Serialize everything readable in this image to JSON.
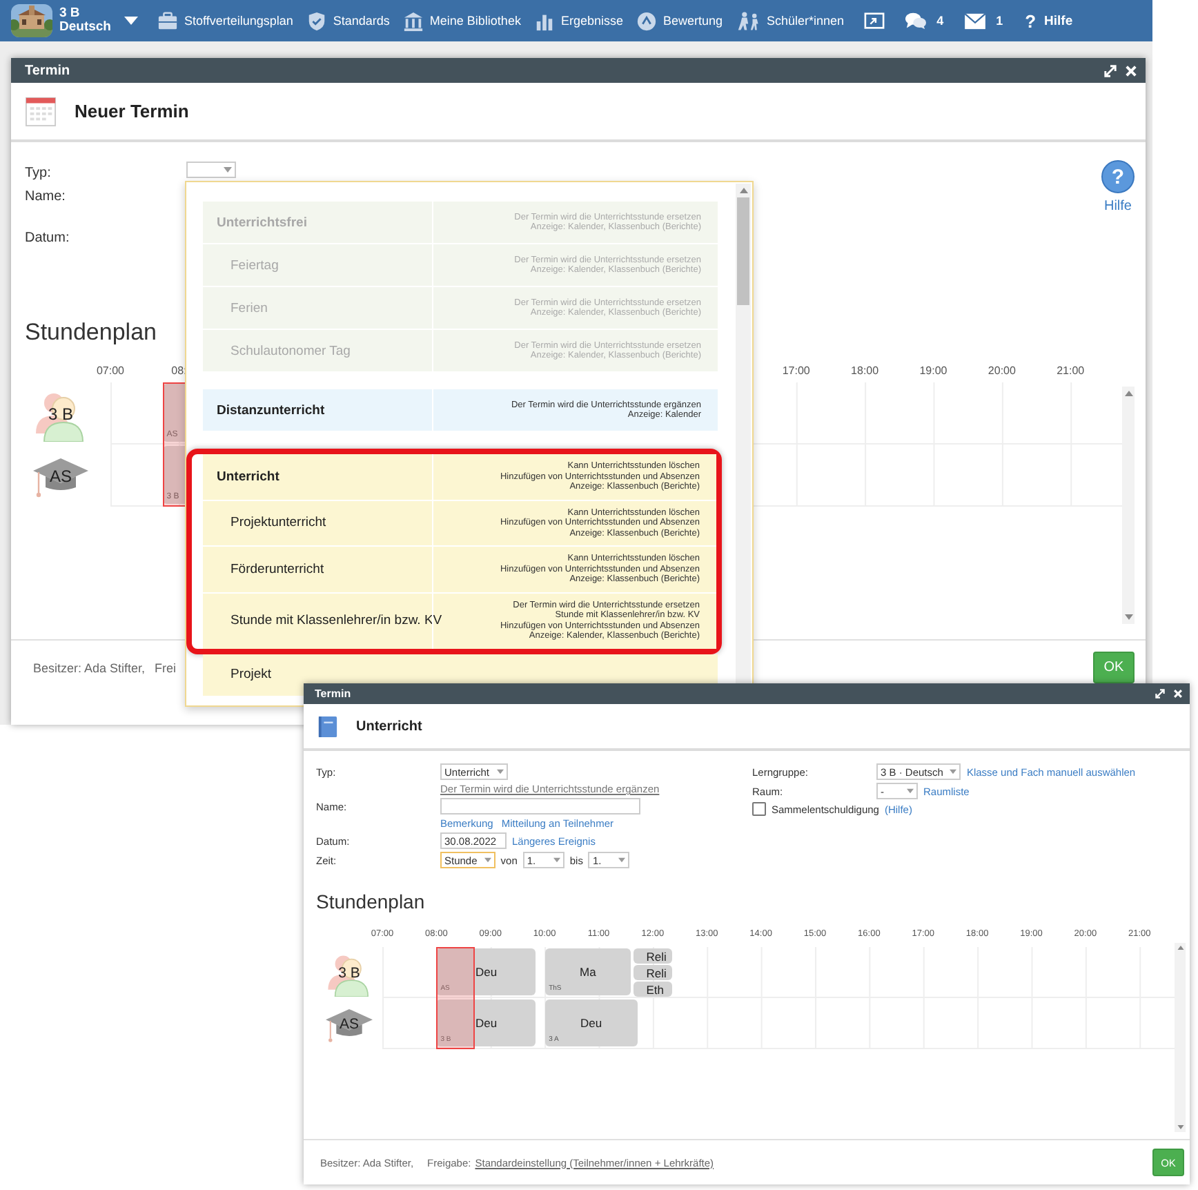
{
  "nav": {
    "class_label": "3 B",
    "subject_label": "Deutsch",
    "items": [
      {
        "label": "Stoffverteilungsplan"
      },
      {
        "label": "Standards"
      },
      {
        "label": "Meine Bibliothek"
      },
      {
        "label": "Ergebnisse"
      },
      {
        "label": "Bewertung"
      },
      {
        "label": "Schüler*innen"
      }
    ],
    "counters": [
      {
        "count": "4"
      },
      {
        "count": "1"
      }
    ],
    "help": {
      "glyph": "?",
      "label": "Hilfe"
    }
  },
  "dialog_new": {
    "title": "Termin",
    "heading": "Neuer Termin",
    "labels": [
      "Typ:",
      "Name:",
      "Datum:"
    ],
    "help": {
      "glyph": "?",
      "label": "Hilfe"
    },
    "schedule_title": "Stundenplan",
    "hours_left": [
      "07:00",
      "08:"
    ],
    "hours_right": [
      "17:00",
      "18:00",
      "19:00",
      "20:00",
      "21:00"
    ],
    "rows": [
      {
        "label": "3 B",
        "kind": "class",
        "lessons": [
          {
            "note": "AS"
          }
        ]
      },
      {
        "label": "AS",
        "kind": "teacher",
        "lessons": [
          {
            "note": "3 B"
          }
        ]
      }
    ],
    "owner": "Besitzer: Ada Stifter,",
    "sharing": "Frei",
    "ok": "OK"
  },
  "type_menu": {
    "items": [
      {
        "text": "Unterrichtsfrei",
        "kind": "header",
        "disabled": true,
        "color": "#f3f6ee",
        "highlighted": false,
        "description": [
          "Der Termin wird die Unterrichtsstunde ersetzen",
          "Anzeige: Kalender, Klassenbuch (Berichte)"
        ]
      },
      {
        "text": "Feiertag",
        "kind": "option",
        "disabled": true,
        "color": "#f3f6ee",
        "highlighted": false,
        "description": [
          "Der Termin wird die Unterrichtsstunde ersetzen",
          "Anzeige: Kalender, Klassenbuch (Berichte)"
        ]
      },
      {
        "text": "Ferien",
        "kind": "option",
        "disabled": true,
        "color": "#f3f6ee",
        "highlighted": false,
        "description": [
          "Der Termin wird die Unterrichtsstunde ersetzen",
          "Anzeige: Kalender, Klassenbuch (Berichte)"
        ]
      },
      {
        "text": "Schulautonomer Tag",
        "kind": "option",
        "disabled": true,
        "color": "#f3f6ee",
        "highlighted": false,
        "description": [
          "Der Termin wird die Unterrichtsstunde ersetzen",
          "Anzeige: Kalender, Klassenbuch (Berichte)"
        ]
      },
      {
        "text": "Distanzunterricht",
        "kind": "header",
        "disabled": false,
        "color": "#eaf5fc",
        "highlighted": false,
        "description": [
          "Der Termin wird die Unterrichtsstunde ergänzen",
          "Anzeige: Kalender"
        ]
      },
      {
        "text": "Unterricht",
        "kind": "header",
        "disabled": false,
        "color": "#fcf6d2",
        "highlighted": true,
        "description": [
          "Kann Unterrichtsstunden löschen",
          "Hinzufügen von Unterrichtsstunden und Absenzen",
          "Anzeige: Klassenbuch (Berichte)"
        ]
      },
      {
        "text": "Projektunterricht",
        "kind": "option",
        "disabled": false,
        "color": "#fcf6d2",
        "highlighted": true,
        "description": [
          "Kann Unterrichtsstunden löschen",
          "Hinzufügen von Unterrichtsstunden und Absenzen",
          "Anzeige: Klassenbuch (Berichte)"
        ]
      },
      {
        "text": "Förderunterricht",
        "kind": "option",
        "disabled": false,
        "color": "#fcf6d2",
        "highlighted": true,
        "description": [
          "Kann Unterrichtsstunden löschen",
          "Hinzufügen von Unterrichtsstunden und Absenzen",
          "Anzeige: Klassenbuch (Berichte)"
        ]
      },
      {
        "text": "Stunde mit Klassenlehrer/in bzw. KV",
        "kind": "option",
        "disabled": false,
        "color": "#fcf6d2",
        "highlighted": true,
        "description": [
          "Der Termin wird die Unterrichtsstunde ersetzen",
          "Stunde mit Klassenlehrer/in bzw. KV",
          "Hinzufügen von Unterrichtsstunden und Absenzen",
          "Anzeige: Kalender, Klassenbuch (Berichte)"
        ]
      },
      {
        "text": "Projekt",
        "kind": "option",
        "disabled": false,
        "color": "#fcf6d2",
        "highlighted": false
      }
    ]
  },
  "dialog_lesson": {
    "title": "Termin",
    "heading": "Unterricht",
    "type": {
      "label": "Typ:",
      "value": "Unterricht",
      "hint": "Der Termin wird die Unterrichtsstunde ergänzen"
    },
    "name": {
      "label": "Name:",
      "links": [
        "Bemerkung",
        "Mitteilung an Teilnehmer"
      ]
    },
    "date": {
      "label": "Datum:",
      "value": "30.08.2022",
      "link": "Längeres Ereignis"
    },
    "time": {
      "label": "Zeit:",
      "mode": "Stunde",
      "focused": true,
      "from_label": "von",
      "from": "1.",
      "to_label": "bis",
      "to": "1."
    },
    "group": {
      "label": "Lerngruppe:",
      "value": "3 B · Deutsch",
      "link": "Klasse und Fach manuell auswählen"
    },
    "room": {
      "label": "Raum:",
      "value": "-",
      "link": "Raumliste"
    },
    "excuse": {
      "label": "Sammelentschuldigung",
      "checked": false,
      "link": "(Hilfe)"
    },
    "schedule_title": "Stundenplan",
    "hours": [
      "07:00",
      "08:00",
      "09:00",
      "10:00",
      "11:00",
      "12:00",
      "13:00",
      "14:00",
      "15:00",
      "16:00",
      "17:00",
      "18:00",
      "19:00",
      "20:00",
      "21:00"
    ],
    "rows": [
      {
        "label": "3 B",
        "kind": "class",
        "lessons": [
          {
            "subject": "Deu",
            "note": "AS",
            "kind": "block"
          },
          {
            "subject": "Ma",
            "note": "ThS",
            "kind": "block"
          },
          {
            "subject": "Reli",
            "kind": "small"
          },
          {
            "subject": "Reli",
            "kind": "small"
          },
          {
            "subject": "Eth",
            "kind": "small"
          }
        ]
      },
      {
        "label": "AS",
        "kind": "teacher",
        "lessons": [
          {
            "subject": "Deu",
            "note": "3 B",
            "kind": "block"
          },
          {
            "subject": "Deu",
            "note": "3 A",
            "kind": "block"
          }
        ]
      }
    ],
    "owner": "Besitzer: Ada Stifter,",
    "sharing_label": "Freigabe:",
    "sharing": "Standardeinstellung (Teilnehmer/innen + Lehrkräfte)",
    "ok": "OK"
  }
}
